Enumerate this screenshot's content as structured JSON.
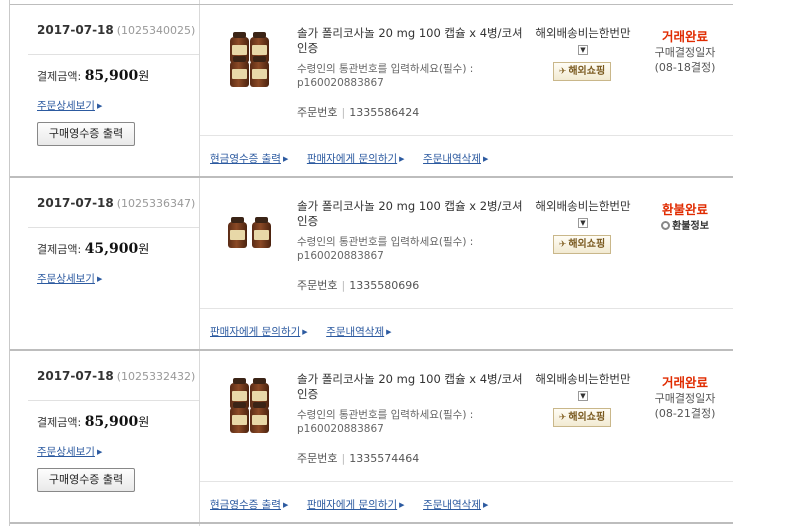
{
  "orders": [
    {
      "date": "2017-07-18",
      "order_id": "(1025340025)",
      "payment_label": "결제금액:",
      "payment_amount": "85,900",
      "payment_unit": "원",
      "detail_link": "주문상세보기",
      "receipt_button": "구매영수증 출력",
      "product_name": "솔가 폴리코사놀 20 mg 100 캡슐 x 4병/코셔인증",
      "note": "수령인의 통관번호를 입력하세요(필수) : p160020883867",
      "order_no_label": "주문번호",
      "order_no": "1335586424",
      "shipping": "해외배송비는한번만",
      "badge": "해외쇼핑",
      "status": "거래완료",
      "status_color": "#e02b00",
      "sub1": "구매결정일자",
      "sub2": "(08-18결정)",
      "actions": [
        "현금영수증 출력",
        "판매자에게 문의하기",
        "주문내역삭제"
      ]
    },
    {
      "date": "2017-07-18",
      "order_id": "(1025336347)",
      "payment_label": "결제금액:",
      "payment_amount": "45,900",
      "payment_unit": "원",
      "detail_link": "주문상세보기",
      "product_name": "솔가 폴리코사놀 20 mg 100 캡슐 x 2병/코셔인증",
      "note": "수령인의 통관번호를 입력하세요(필수) : p160020883867",
      "order_no_label": "주문번호",
      "order_no": "1335580696",
      "shipping": "해외배송비는한번만",
      "badge": "해외쇼핑",
      "status": "환불완료",
      "status_color": "#e02b00",
      "refund_info": "환불정보",
      "actions": [
        "판매자에게 문의하기",
        "주문내역삭제"
      ]
    },
    {
      "date": "2017-07-18",
      "order_id": "(1025332432)",
      "payment_label": "결제금액:",
      "payment_amount": "85,900",
      "payment_unit": "원",
      "detail_link": "주문상세보기",
      "receipt_button": "구매영수증 출력",
      "product_name": "솔가 폴리코사놀 20 mg 100 캡슐 x 4병/코셔인증",
      "note": "수령인의 통관번호를 입력하세요(필수) : p160020883867",
      "order_no_label": "주문번호",
      "order_no": "1335574464",
      "shipping": "해외배송비는한번만",
      "badge": "해외쇼핑",
      "status": "거래완료",
      "status_color": "#e02b00",
      "sub1": "구매결정일자",
      "sub2": "(08-21결정)",
      "actions": [
        "현금영수증 출력",
        "판매자에게 문의하기",
        "주문내역삭제"
      ]
    }
  ]
}
